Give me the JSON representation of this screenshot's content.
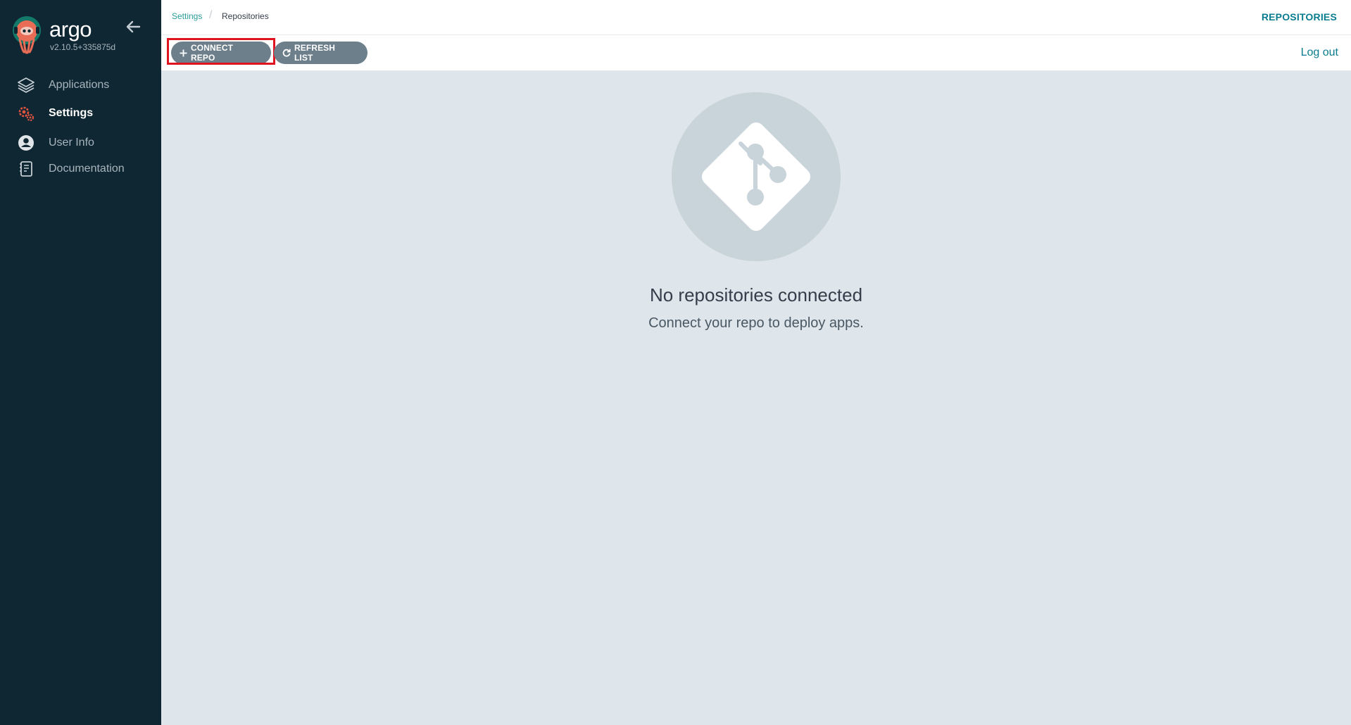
{
  "sidebar": {
    "brand": "argo",
    "version": "v2.10.5+335875d",
    "items": [
      {
        "label": "Applications",
        "icon": "layers-icon"
      },
      {
        "label": "Settings",
        "icon": "gears-icon",
        "active": true
      },
      {
        "label": "User Info",
        "icon": "user-circle-icon"
      },
      {
        "label": "Documentation",
        "icon": "book-icon"
      }
    ]
  },
  "topbar": {
    "breadcrumb": [
      "Settings",
      "Repositories"
    ],
    "page_tag": "REPOSITORIES"
  },
  "toolbar": {
    "connect_label": "CONNECT REPO",
    "refresh_label": "REFRESH LIST",
    "logout_label": "Log out"
  },
  "empty_state": {
    "icon": "git-icon",
    "title": "No repositories connected",
    "subtitle": "Connect your repo to deploy apps."
  },
  "colors": {
    "sidebar_bg": "#0f2733",
    "accent": "#0a7c8f",
    "button_bg": "#6d7f8b",
    "highlight": "#e0141e",
    "settings_icon": "#e0533f"
  }
}
